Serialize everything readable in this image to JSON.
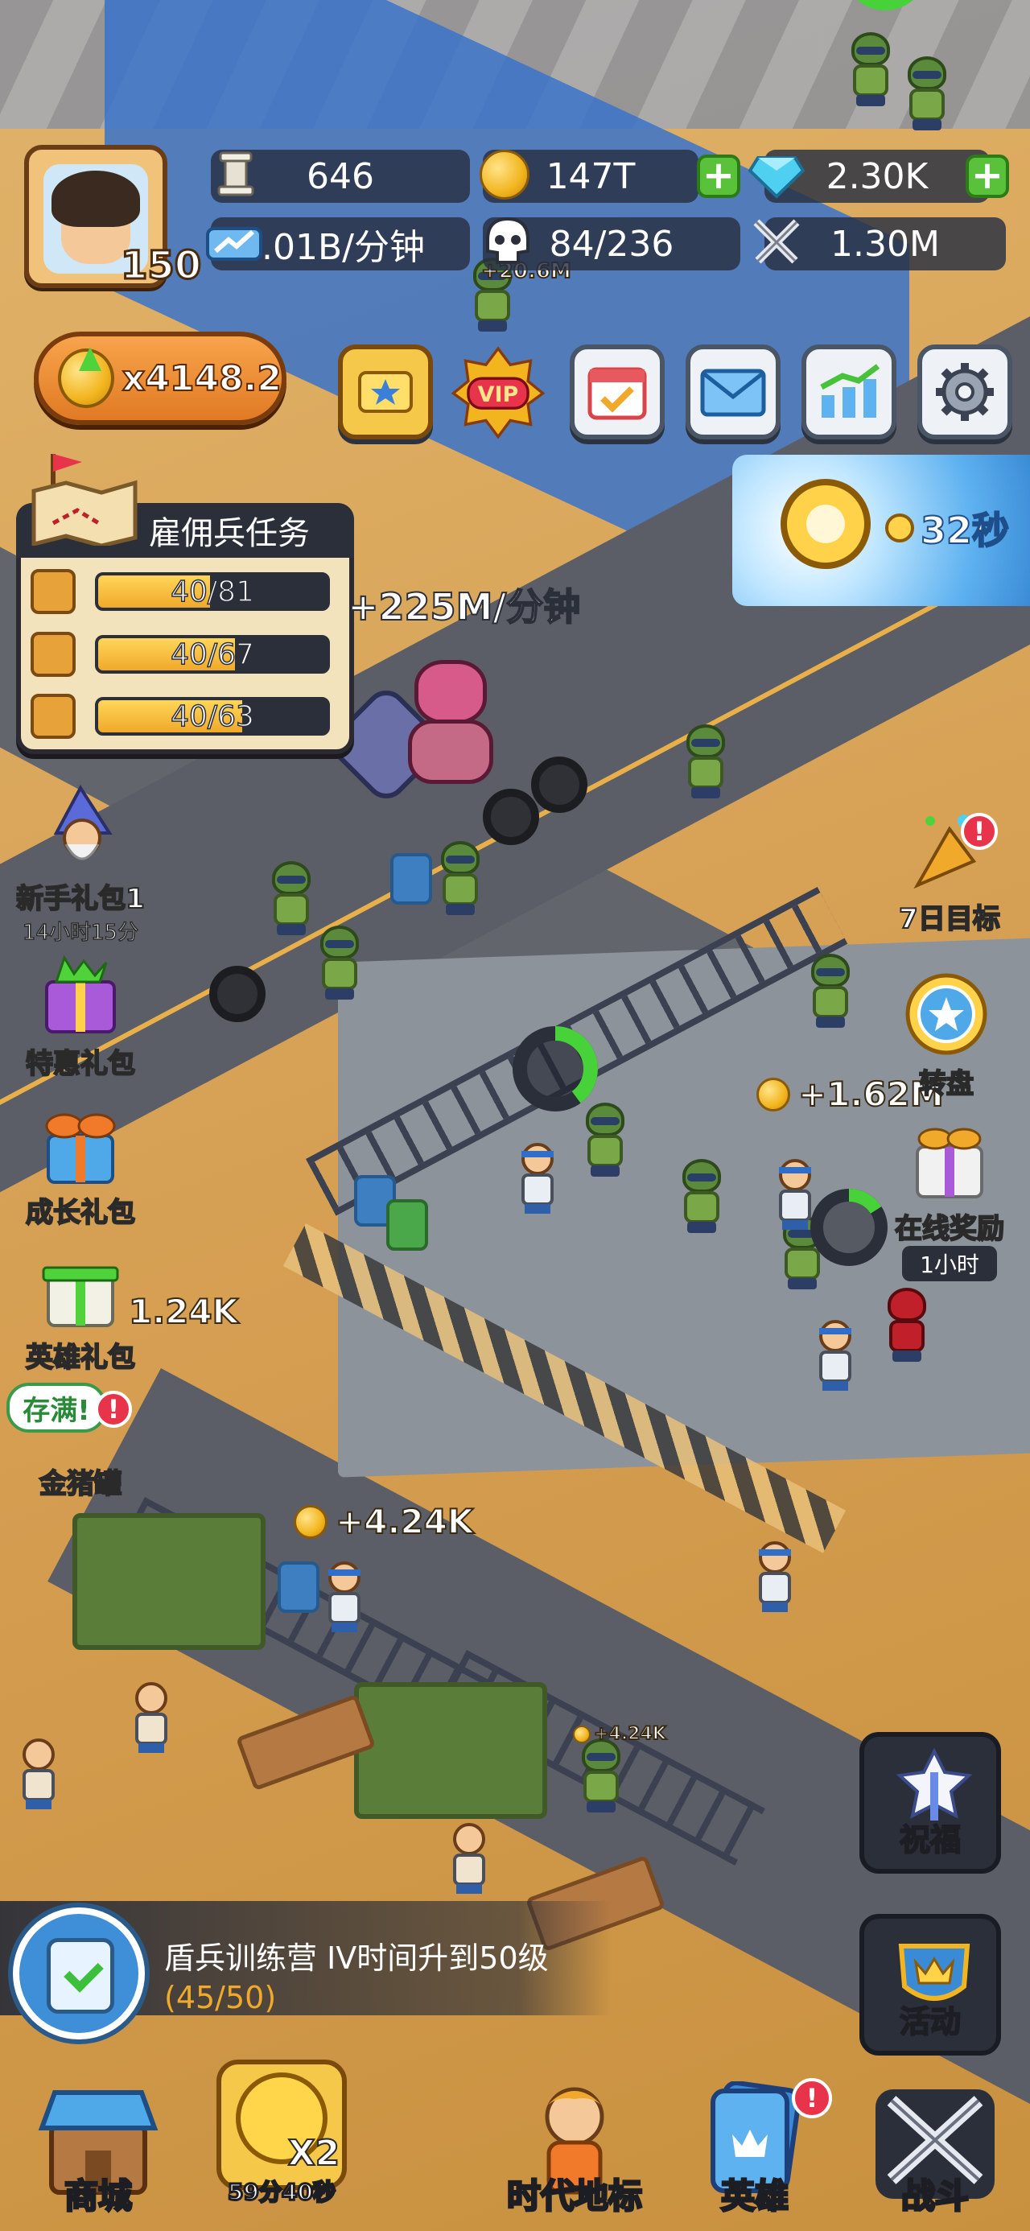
{
  "resources": {
    "stone": "646",
    "gold": "147T",
    "diamond": "2.30K",
    "rate": "9.01B/分钟",
    "population": "84/236",
    "power": "1.30M"
  },
  "player": {
    "level": "150"
  },
  "multiplier": "x4148.2",
  "top_buttons": [
    "pass-icon",
    "vip-icon",
    "calendar-icon",
    "mail-icon",
    "stats-icon",
    "gear-icon"
  ],
  "vip_label": "VIP",
  "timer": {
    "value": "32秒"
  },
  "mission": {
    "title": "雇佣兵任务",
    "rows": [
      {
        "icon": "sword-icon",
        "value": "40/81",
        "progress": 0.49
      },
      {
        "icon": "bow-icon",
        "value": "40/67",
        "progress": 0.6
      },
      {
        "icon": "shield-icon",
        "value": "40/63",
        "progress": 0.63
      }
    ]
  },
  "rate_float": "+225M/分钟",
  "left_side": {
    "newbie_pack": "新手礼包1",
    "newbie_timer": "14小时15分",
    "special_pack": "特惠礼包",
    "growth_pack": "成长礼包",
    "hero_pack": "英雄礼包",
    "piggy_full": "存满!",
    "piggy": "金猪罐"
  },
  "right_side": {
    "seven_day": "7日目标",
    "wheel": "转盘",
    "online_reward": "在线奖励",
    "online_timer": "1小时"
  },
  "floats": {
    "small_top": "+20.6M",
    "yard": "+1.62M",
    "left_k": "1.24K",
    "mid": "+4.24K",
    "small_bottom": "+4.24K"
  },
  "quest": {
    "title": "盾兵训练营 IV时间升到50级",
    "progress": "(45/50)"
  },
  "right_buttons": {
    "blessing": "祝福",
    "activity": "活动"
  },
  "nav": {
    "shop": "商城",
    "boost_timer": "59分40秒",
    "boost_label": "X2",
    "landmark": "时代地标",
    "hero": "英雄",
    "battle": "战斗"
  },
  "colors": {
    "accent_orange": "#e17a24",
    "panel_dark": "#2b2f3a",
    "gold": "#f2b51f",
    "plus_green": "#5ac23a",
    "alert_red": "#e8344a"
  }
}
